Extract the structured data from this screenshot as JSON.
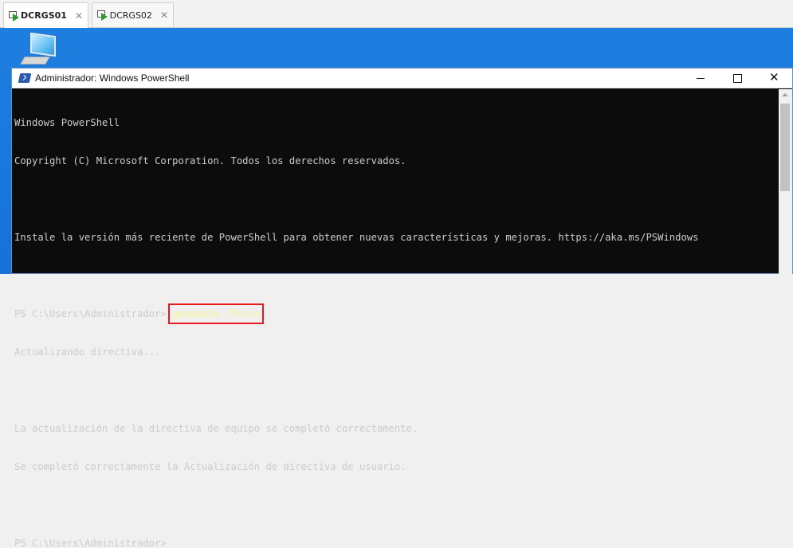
{
  "tabs": [
    {
      "label": "DCRGS01",
      "active": true
    },
    {
      "label": "DCRGS02",
      "active": false
    }
  ],
  "window": {
    "title": "Administrador: Windows PowerShell"
  },
  "console": {
    "lines": [
      "Windows PowerShell",
      "Copyright (C) Microsoft Corporation. Todos los derechos reservados.",
      "",
      "Instale la versión más reciente de PowerShell para obtener nuevas características y mejoras. https://aka.ms/PSWindows",
      "",
      "PS C:\\Users\\Administrador> ",
      "Actualizando directiva...",
      "",
      "La actualización de la directiva de equipo se completó correctamente.",
      "Se completó correctamente la Actualización de directiva de usuario.",
      "",
      "PS C:\\Users\\Administrador>"
    ],
    "command": "gpupdate /force"
  },
  "colors": {
    "highlight_box": "#e8181c",
    "console_bg": "#0c0c0c",
    "command_text": "#f5f590",
    "desktop_bg": "#1e7fe0"
  },
  "icons": {
    "tab": "vm-running-icon",
    "desktop": "this-pc-icon",
    "window": "powershell-icon"
  }
}
